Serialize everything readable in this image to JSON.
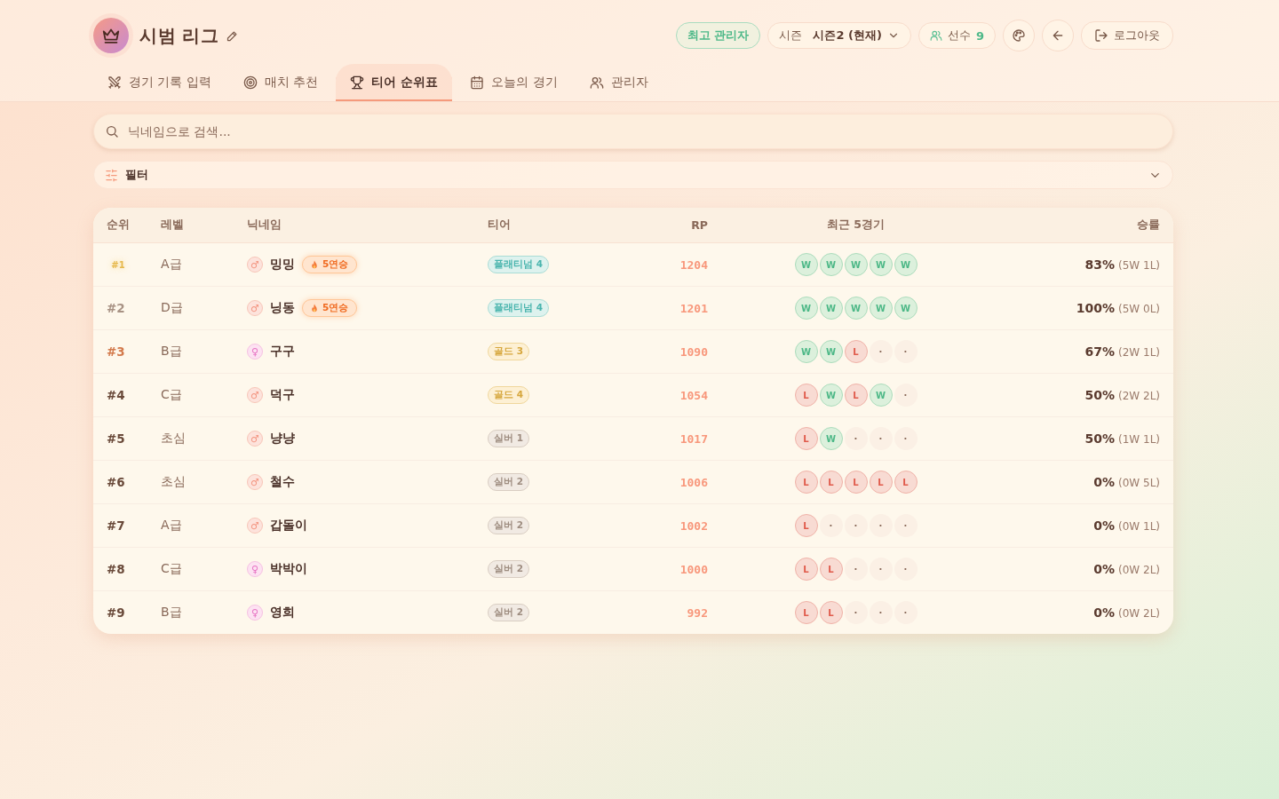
{
  "header": {
    "title": "시범 리그",
    "role_badge": "최고 관리자",
    "season": {
      "label": "시즌",
      "value": "시즌2 (현재)"
    },
    "players": {
      "label": "선수",
      "count": "9"
    },
    "logout": "로그아웃"
  },
  "tabs": [
    {
      "label": "경기 기록 입력",
      "selected": false
    },
    {
      "label": "매치 추천",
      "selected": false
    },
    {
      "label": "티어 순위표",
      "selected": true
    },
    {
      "label": "오늘의 경기",
      "selected": false
    },
    {
      "label": "관리자",
      "selected": false
    }
  ],
  "search": {
    "placeholder": "닉네임으로 검색..."
  },
  "filter": {
    "label": "필터",
    "expanded": false
  },
  "table": {
    "columns": [
      "순위",
      "레벨",
      "닉네임",
      "티어",
      "RP",
      "최근 5경기",
      "승률"
    ],
    "rows": [
      {
        "rank": "#1",
        "level": "A급",
        "gender": {
          "kind": "male",
          "symbol": "♂"
        },
        "nickname": "밍밍",
        "streak": "5연승",
        "tier": {
          "kind": "platinum",
          "label": "플래티넘 4"
        },
        "rp": "1204",
        "recent": [
          {
            "kind": "win",
            "label": "W"
          },
          {
            "kind": "win",
            "label": "W"
          },
          {
            "kind": "win",
            "label": "W"
          },
          {
            "kind": "win",
            "label": "W"
          },
          {
            "kind": "win",
            "label": "W"
          }
        ],
        "rate": "83%",
        "record": "(5W 1L)"
      },
      {
        "rank": "#2",
        "level": "D급",
        "gender": {
          "kind": "male",
          "symbol": "♂"
        },
        "nickname": "닝동",
        "streak": "5연승",
        "tier": {
          "kind": "platinum",
          "label": "플래티넘 4"
        },
        "rp": "1201",
        "recent": [
          {
            "kind": "win",
            "label": "W"
          },
          {
            "kind": "win",
            "label": "W"
          },
          {
            "kind": "win",
            "label": "W"
          },
          {
            "kind": "win",
            "label": "W"
          },
          {
            "kind": "win",
            "label": "W"
          }
        ],
        "rate": "100%",
        "record": "(5W 0L)"
      },
      {
        "rank": "#3",
        "level": "B급",
        "gender": {
          "kind": "female",
          "symbol": "♀"
        },
        "nickname": "구구",
        "tier": {
          "kind": "gold",
          "label": "골드 3"
        },
        "rp": "1090",
        "recent": [
          {
            "kind": "win",
            "label": "W"
          },
          {
            "kind": "win",
            "label": "W"
          },
          {
            "kind": "loss",
            "label": "L"
          },
          {
            "kind": "none",
            "label": "·"
          },
          {
            "kind": "none",
            "label": "·"
          }
        ],
        "rate": "67%",
        "record": "(2W 1L)"
      },
      {
        "rank": "#4",
        "level": "C급",
        "gender": {
          "kind": "male",
          "symbol": "♂"
        },
        "nickname": "덕구",
        "tier": {
          "kind": "gold",
          "label": "골드 4"
        },
        "rp": "1054",
        "recent": [
          {
            "kind": "loss",
            "label": "L"
          },
          {
            "kind": "win",
            "label": "W"
          },
          {
            "kind": "loss",
            "label": "L"
          },
          {
            "kind": "win",
            "label": "W"
          },
          {
            "kind": "none",
            "label": "·"
          }
        ],
        "rate": "50%",
        "record": "(2W 2L)"
      },
      {
        "rank": "#5",
        "level": "초심",
        "gender": {
          "kind": "male",
          "symbol": "♂"
        },
        "nickname": "냥냥",
        "tier": {
          "kind": "silver",
          "label": "실버 1"
        },
        "rp": "1017",
        "recent": [
          {
            "kind": "loss",
            "label": "L"
          },
          {
            "kind": "win",
            "label": "W"
          },
          {
            "kind": "none",
            "label": "·"
          },
          {
            "kind": "none",
            "label": "·"
          },
          {
            "kind": "none",
            "label": "·"
          }
        ],
        "rate": "50%",
        "record": "(1W 1L)"
      },
      {
        "rank": "#6",
        "level": "초심",
        "gender": {
          "kind": "male",
          "symbol": "♂"
        },
        "nickname": "철수",
        "tier": {
          "kind": "silver",
          "label": "실버 2"
        },
        "rp": "1006",
        "recent": [
          {
            "kind": "loss",
            "label": "L"
          },
          {
            "kind": "loss",
            "label": "L"
          },
          {
            "kind": "loss",
            "label": "L"
          },
          {
            "kind": "loss",
            "label": "L"
          },
          {
            "kind": "loss",
            "label": "L"
          }
        ],
        "rate": "0%",
        "record": "(0W 5L)"
      },
      {
        "rank": "#7",
        "level": "A급",
        "gender": {
          "kind": "male",
          "symbol": "♂"
        },
        "nickname": "갑돌이",
        "tier": {
          "kind": "silver",
          "label": "실버 2"
        },
        "rp": "1002",
        "recent": [
          {
            "kind": "loss",
            "label": "L"
          },
          {
            "kind": "none",
            "label": "·"
          },
          {
            "kind": "none",
            "label": "·"
          },
          {
            "kind": "none",
            "label": "·"
          },
          {
            "kind": "none",
            "label": "·"
          }
        ],
        "rate": "0%",
        "record": "(0W 1L)"
      },
      {
        "rank": "#8",
        "level": "C급",
        "gender": {
          "kind": "female",
          "symbol": "♀"
        },
        "nickname": "박박이",
        "tier": {
          "kind": "silver",
          "label": "실버 2"
        },
        "rp": "1000",
        "recent": [
          {
            "kind": "loss",
            "label": "L"
          },
          {
            "kind": "loss",
            "label": "L"
          },
          {
            "kind": "none",
            "label": "·"
          },
          {
            "kind": "none",
            "label": "·"
          },
          {
            "kind": "none",
            "label": "·"
          }
        ],
        "rate": "0%",
        "record": "(0W 2L)"
      },
      {
        "rank": "#9",
        "level": "B급",
        "gender": {
          "kind": "female",
          "symbol": "♀"
        },
        "nickname": "영희",
        "tier": {
          "kind": "silver",
          "label": "실버 2"
        },
        "rp": "992",
        "recent": [
          {
            "kind": "loss",
            "label": "L"
          },
          {
            "kind": "loss",
            "label": "L"
          },
          {
            "kind": "none",
            "label": "·"
          },
          {
            "kind": "none",
            "label": "·"
          },
          {
            "kind": "none",
            "label": "·"
          }
        ],
        "rate": "0%",
        "record": "(0W 2L)"
      }
    ]
  }
}
